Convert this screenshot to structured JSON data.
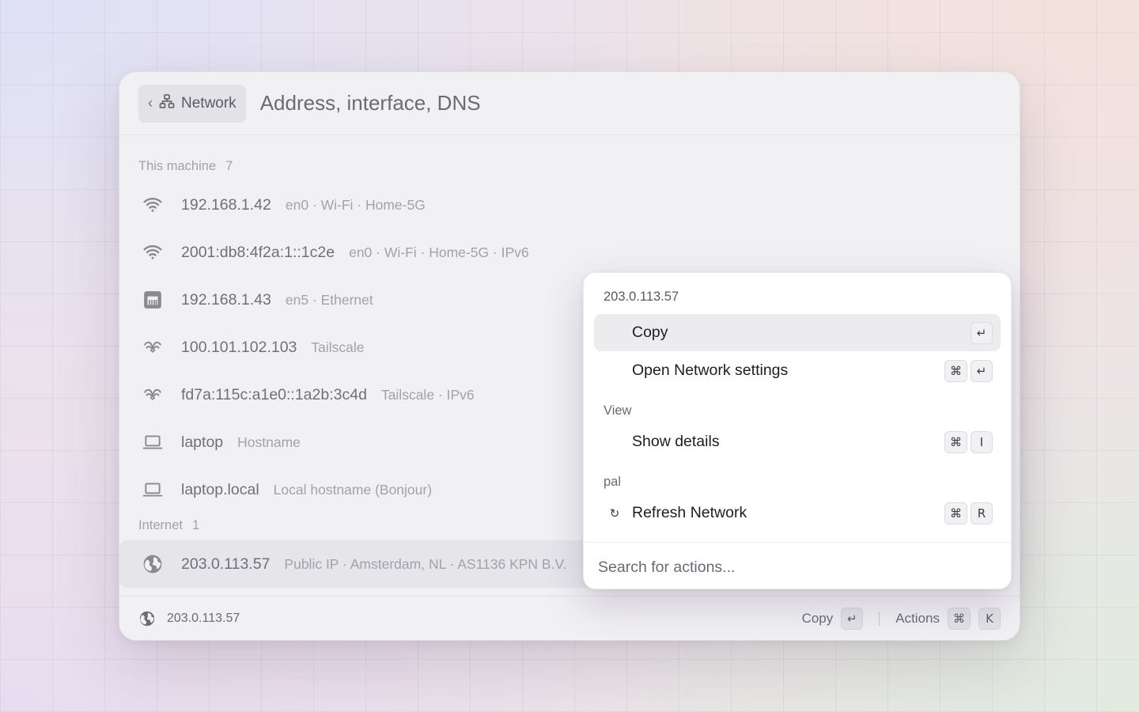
{
  "header": {
    "back_label": "Network",
    "title": "Address, interface, DNS"
  },
  "sections": {
    "machine": {
      "title": "This machine",
      "count": "7"
    },
    "internet": {
      "title": "Internet",
      "count": "1"
    }
  },
  "rows": [
    {
      "icon": "wifi-icon",
      "primary": "192.168.1.42",
      "secondary": "en0 · Wi-Fi · Home-5G"
    },
    {
      "icon": "wifi-icon",
      "primary": "2001:db8:4f2a:1::1c2e",
      "secondary": "en0 · Wi-Fi · Home-5G · IPv6"
    },
    {
      "icon": "ethernet-icon",
      "primary": "192.168.1.43",
      "secondary": "en5 · Ethernet"
    },
    {
      "icon": "tailscale-icon",
      "primary": "100.101.102.103",
      "secondary": "Tailscale"
    },
    {
      "icon": "tailscale-icon",
      "primary": "fd7a:115c:a1e0::1a2b:3c4d",
      "secondary": "Tailscale · IPv6"
    },
    {
      "icon": "laptop-icon",
      "primary": "laptop",
      "secondary": "Hostname"
    },
    {
      "icon": "laptop-icon",
      "primary": "laptop.local",
      "secondary": "Local hostname (Bonjour)"
    }
  ],
  "internet_row": {
    "icon": "globe-icon",
    "primary": "203.0.113.57",
    "secondary": "Public IP · Amsterdam, NL · AS1136 KPN B.V."
  },
  "footer": {
    "selected_value": "203.0.113.57",
    "copy_label": "Copy",
    "copy_key": "↵",
    "actions_label": "Actions",
    "actions_keys": [
      "⌘",
      "K"
    ]
  },
  "popover": {
    "title": "203.0.113.57",
    "items": [
      {
        "label": "Copy",
        "keys": [
          "↵"
        ]
      },
      {
        "label": "Open Network settings",
        "keys": [
          "⌘",
          "↵"
        ]
      }
    ],
    "view_section": "View",
    "view_items": [
      {
        "label": "Show details",
        "keys": [
          "⌘",
          "I"
        ]
      }
    ],
    "pal_section": "pal",
    "pal_items": [
      {
        "icon": "refresh-icon",
        "glyph": "↻",
        "label": "Refresh Network",
        "keys": [
          "⌘",
          "R"
        ]
      }
    ],
    "search_placeholder": "Search for actions..."
  }
}
